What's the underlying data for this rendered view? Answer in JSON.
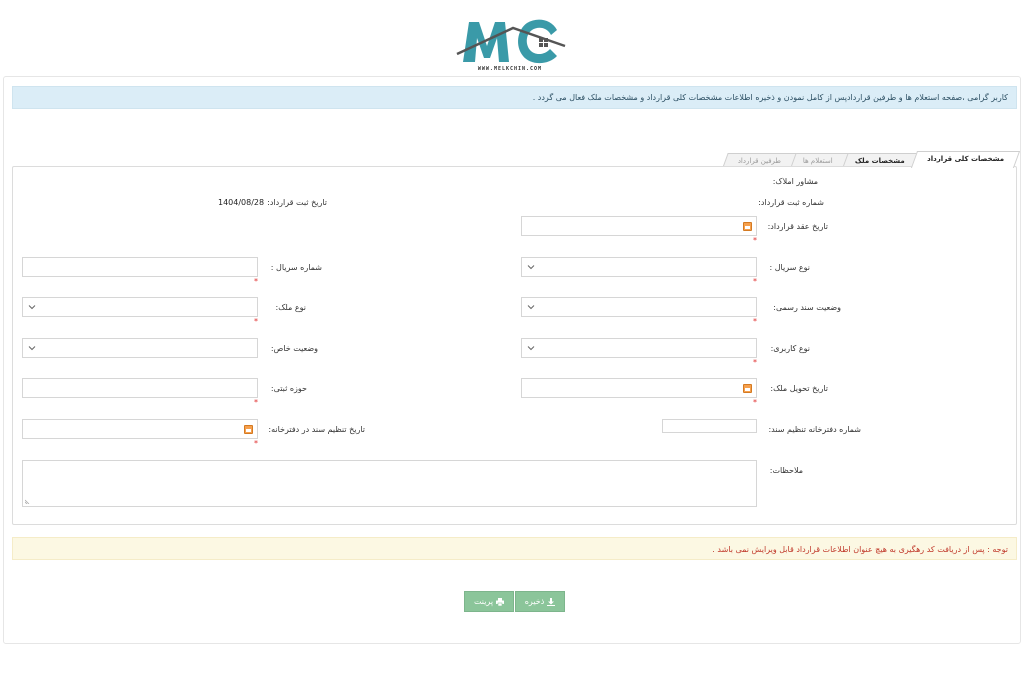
{
  "logo": {
    "letters": "MC",
    "url": "WWW.MELKCHIN.COM"
  },
  "info_banner": "کاربر گرامی ،صفحه استعلام ها و طرفین قراردادپس از کامل نمودن و ذخیره اطلاعات مشخصات کلی قرارداد و مشخصات ملک فعال می گردد .",
  "tabs": [
    {
      "label": "مشخصات کلی قرارداد",
      "state": "active"
    },
    {
      "label": "مشخصات ملک",
      "state": "enabled"
    },
    {
      "label": "استعلام ها",
      "state": "disabled"
    },
    {
      "label": "طرفین قرارداد",
      "state": "disabled"
    }
  ],
  "form": {
    "advisor_label": "مشاور املاک:",
    "reg_number_label": "شماره ثبت قرارداد:",
    "reg_date_label": "تاریخ ثبت قرارداد:",
    "reg_date_value": "1404/08/28",
    "contract_date_label": "تاریخ عقد قرارداد:",
    "serial_type_label": "نوع سریال :",
    "serial_number_label": "شماره سریال :",
    "official_doc_status_label": "وضعیت سند رسمی:",
    "property_type_label": "نوع ملک:",
    "usage_type_label": "نوع کاربری:",
    "special_status_label": "وضعیت خاص:",
    "delivery_date_label": "تاریخ تحویل ملک:",
    "registry_area_label": "حوزه ثبتی:",
    "notary_number_label": "شماره دفترخانه تنظیم سند:",
    "notary_date_label": "تاریخ تنظیم سند در دفترخانه:",
    "notes_label": "ملاحظات:",
    "required_mark": "*"
  },
  "warning_banner": "توجه : پس از دریافت کد رهگیری به هیچ عنوان اطلاعات قرارداد قابل ویرایش نمی باشد .",
  "buttons": {
    "save": "ذخیره",
    "print": "پرینت"
  },
  "colors": {
    "info_bg": "#dbedf7",
    "warn_bg": "#fcf8e3",
    "button": "#8bc59a",
    "calendar": "#f6a04d",
    "logo_teal": "#3a9aa8"
  }
}
